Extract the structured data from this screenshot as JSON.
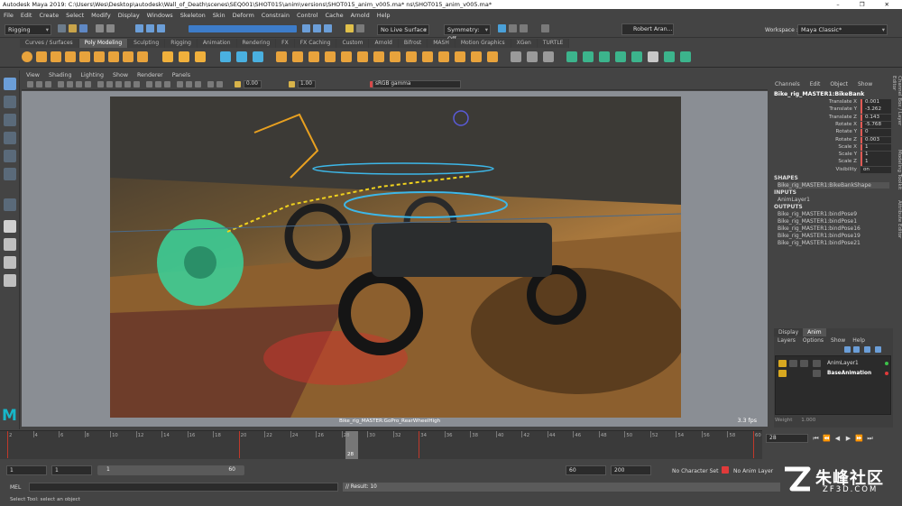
{
  "window": {
    "title": "Autodesk Maya 2019: C:\\Users\\Wes\\Desktop\\autodesk\\Wall_of_Death\\scenes\\SEQ001\\SHOT015\\anim\\versions\\SHOT015_anim_v005.ma*  ns\\SHOT015_anim_v005.ma*",
    "controls": "– ❐ ✕"
  },
  "menus": [
    "File",
    "Edit",
    "Create",
    "Select",
    "Modify",
    "Display",
    "Windows",
    "Skeleton",
    "Skin",
    "Deform",
    "Constrain",
    "Control",
    "Cache",
    "Arnold",
    "Help"
  ],
  "status_line": {
    "menuset": "Rigging",
    "live_surface": "No Live Surface",
    "symmetry": "Symmetry: Off",
    "user": "Robert Aran...",
    "workspace_label": "Workspace :",
    "workspace": "Maya Classic*"
  },
  "shelf_tabs": [
    "Curves / Surfaces",
    "Poly Modeling",
    "Sculpting",
    "Rigging",
    "Animation",
    "Rendering",
    "FX",
    "FX Caching",
    "Custom",
    "Arnold",
    "Bifrost",
    "MASH",
    "Motion Graphics",
    "XGen",
    "TURTLE"
  ],
  "shelf_active": "Poly Modeling",
  "panel_menu": [
    "View",
    "Shading",
    "Lighting",
    "Show",
    "Renderer",
    "Panels"
  ],
  "panel_toolbar": {
    "exposure": "0.00",
    "gamma": "1.00",
    "color_space": "sRGB gamma"
  },
  "viewport": {
    "camera_label": "Bike_rig_MASTER:GoPro_RearWheelHigh",
    "fps": "3.3 fps"
  },
  "channel_box": {
    "menu": [
      "Channels",
      "Edit",
      "Object",
      "Show"
    ],
    "node": "Bike_rig_MASTER1:BikeBank",
    "attributes": [
      {
        "label": "Translate X",
        "value": "0.001",
        "keyed": true
      },
      {
        "label": "Translate Y",
        "value": "-3.262",
        "keyed": true
      },
      {
        "label": "Translate Z",
        "value": "0.143",
        "keyed": true
      },
      {
        "label": "Rotate X",
        "value": "-5.768",
        "keyed": true
      },
      {
        "label": "Rotate Y",
        "value": "0",
        "keyed": true
      },
      {
        "label": "Rotate Z",
        "value": "0.003",
        "keyed": true
      },
      {
        "label": "Scale X",
        "value": "1",
        "keyed": true
      },
      {
        "label": "Scale Y",
        "value": "1",
        "keyed": true
      },
      {
        "label": "Scale Z",
        "value": "1",
        "keyed": true
      },
      {
        "label": "Visibility",
        "value": "on",
        "keyed": false
      }
    ],
    "shapes_header": "SHAPES",
    "shape": "Bike_rig_MASTER1:BikeBankShape",
    "inputs_header": "INPUTS",
    "input": "AnimLayer1",
    "outputs_header": "OUTPUTS",
    "outputs": [
      "Bike_rig_MASTER1:bindPose9",
      "Bike_rig_MASTER1:bindPose1",
      "Bike_rig_MASTER1:bindPose16",
      "Bike_rig_MASTER1:bindPose19",
      "Bike_rig_MASTER1:bindPose21"
    ]
  },
  "side_tabs": [
    "Channel Box / Layer Editor",
    "Modeling Toolkit",
    "Attribute Editor"
  ],
  "layer_editor": {
    "tabs": [
      "Display",
      "Anim"
    ],
    "active_tab": "Anim",
    "menu": [
      "Layers",
      "Options",
      "Show",
      "Help"
    ],
    "layers": [
      {
        "name": "AnimLayer1",
        "dot_color": "#3cc24a"
      },
      {
        "name": "BaseAnimation",
        "dot_color": "#e03a3a"
      }
    ],
    "weight_label": "Weight",
    "weight_value": "1.000"
  },
  "time_slider": {
    "ticks": [
      "2",
      "4",
      "6",
      "8",
      "10",
      "12",
      "14",
      "16",
      "18",
      "20",
      "22",
      "24",
      "26",
      "28",
      "30",
      "32",
      "34",
      "36",
      "38",
      "40",
      "42",
      "44",
      "46",
      "48",
      "50",
      "52",
      "54",
      "56",
      "58",
      "60"
    ],
    "current_frame": "28",
    "current_frame_field": "28"
  },
  "playback_buttons": [
    "⏮",
    "⏪",
    "◀",
    "▶",
    "⏩",
    "⏭"
  ],
  "range": {
    "start": "1",
    "playback_start": "1",
    "slider_start": "1",
    "slider_end": "60",
    "playback_end": "60",
    "end": "200",
    "character_set": "No Character Set",
    "anim_layer": "No Anim Layer"
  },
  "command_line": {
    "mode": "MEL",
    "result": "// Result: 10"
  },
  "help_line": "Select Tool: select an object",
  "watermark": {
    "cn": "朱峰社区",
    "en": "ZF3D.COM"
  }
}
